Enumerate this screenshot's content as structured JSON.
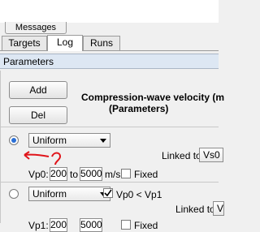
{
  "messages_tab": "Messages",
  "tabs": [
    {
      "label": "Targets",
      "active": false
    },
    {
      "label": "Log",
      "active": true
    },
    {
      "label": "Runs",
      "active": false
    }
  ],
  "parameters_header": "Parameters",
  "buttons": {
    "add": "Add",
    "del": "Del"
  },
  "heading": {
    "line1": "Compression-wave velocity (m",
    "line2": "(Parameters)"
  },
  "row1": {
    "distribution": "Uniform",
    "linked_to_label": "Linked to",
    "linked_to_value": "Vs0",
    "var_label": "Vp0:",
    "min": "200",
    "to_label": "to",
    "max": "5000",
    "unit": "m/s",
    "fixed_label": "Fixed"
  },
  "row2": {
    "distribution": "Uniform",
    "constraint_label": "Vp0 < Vp1",
    "linked_to_label": "Linked to",
    "linked_to_value": "V",
    "var_label": "Vp1:",
    "min": "200",
    "max": "5000",
    "fixed_label": "Fixed"
  },
  "colors": {
    "annotation": "#e0141a",
    "accent": "#2a6fd6",
    "header_bg": "#dde7f3"
  }
}
